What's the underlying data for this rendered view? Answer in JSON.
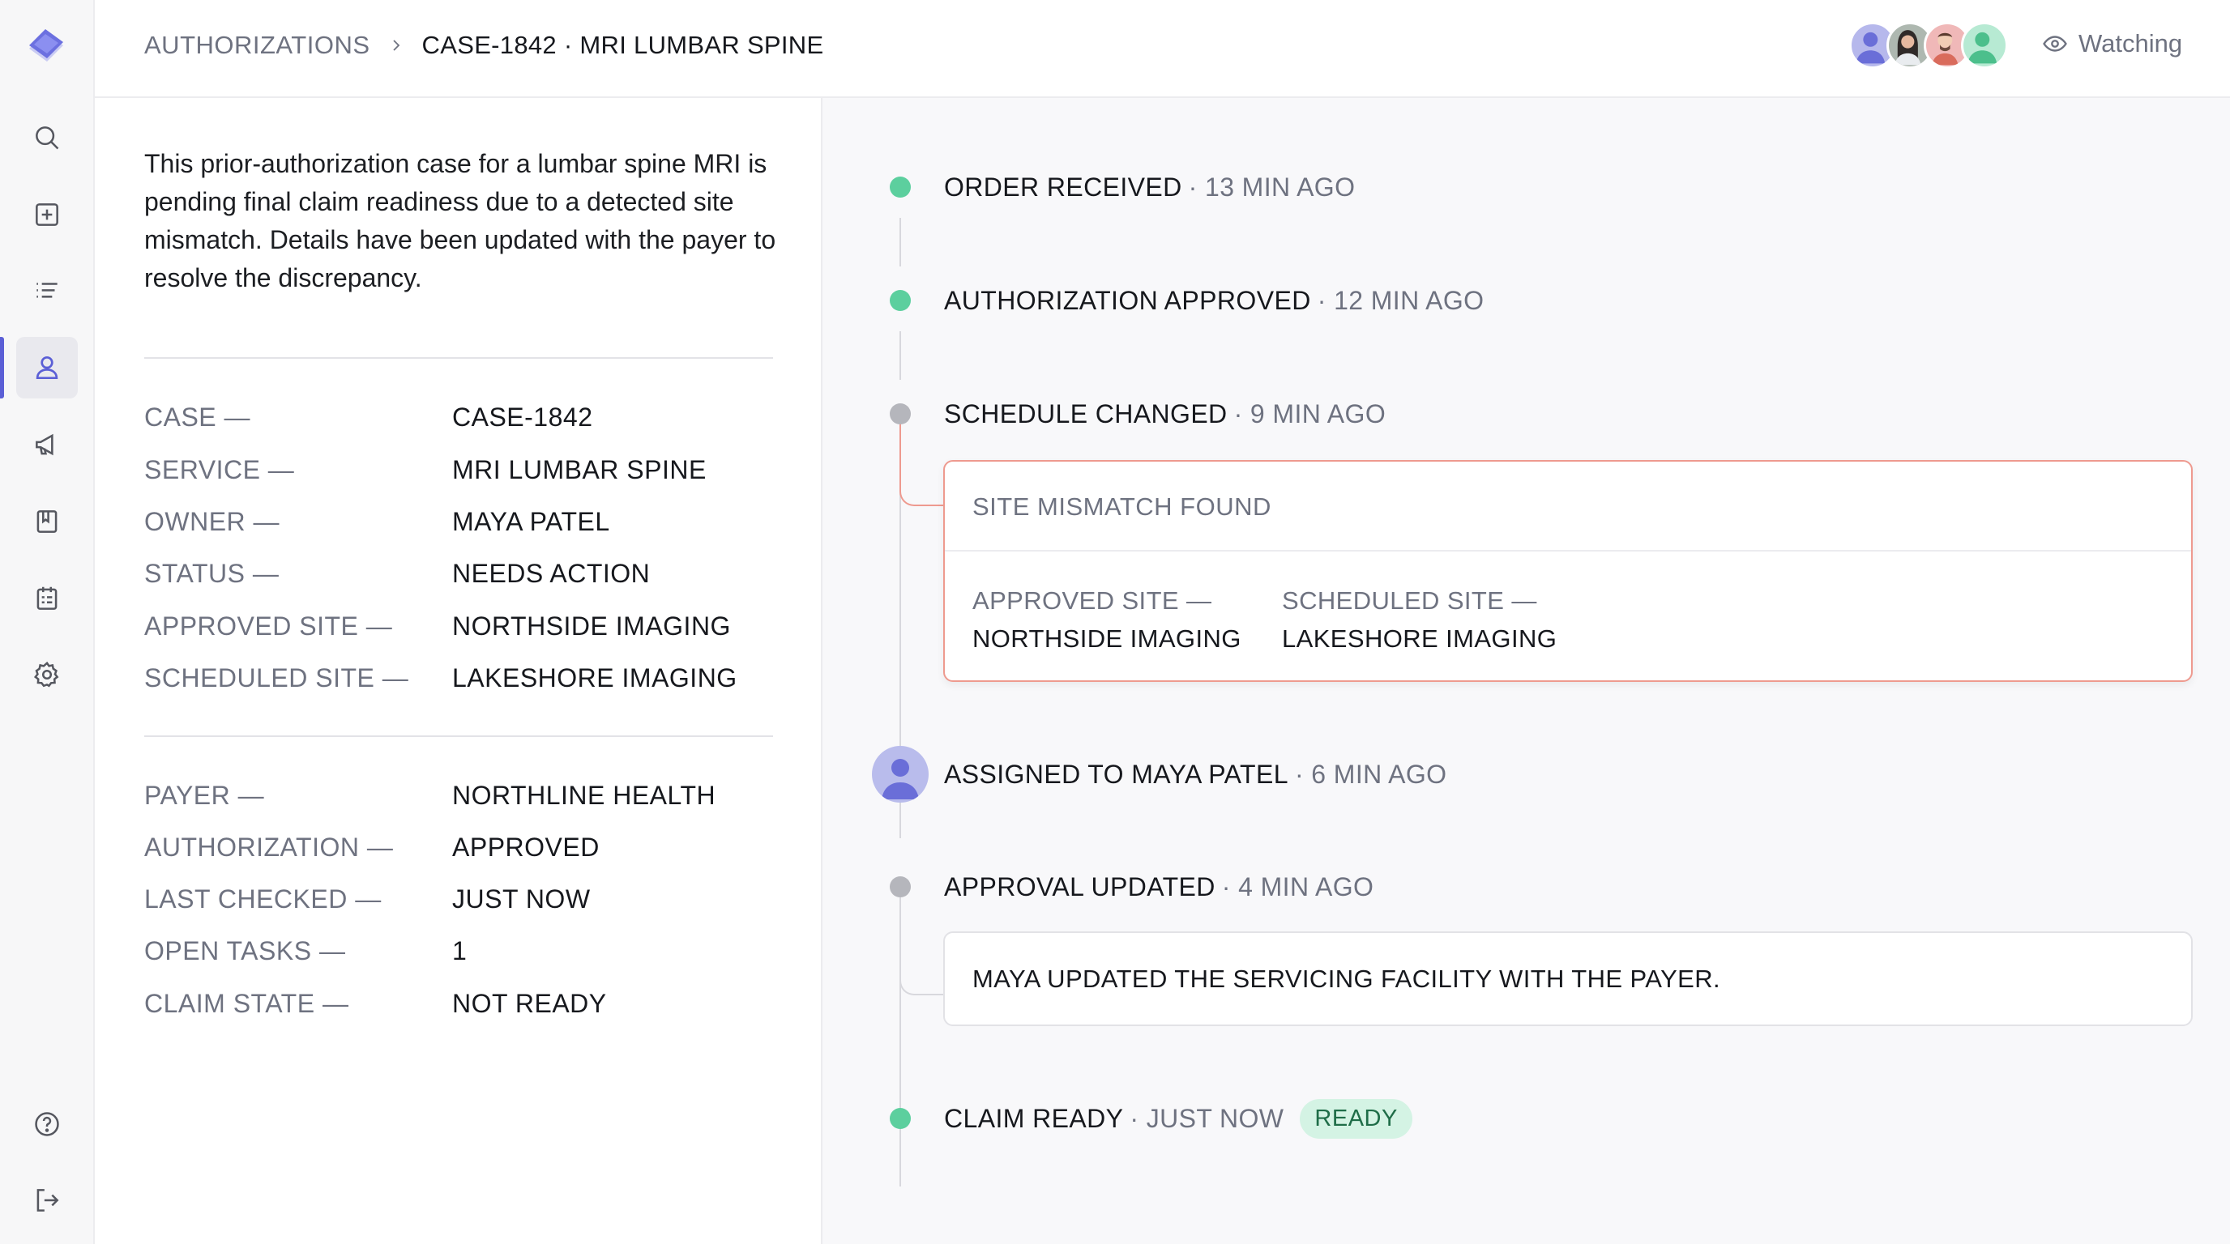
{
  "colors": {
    "accent": "#5b5fd6",
    "status_green": "#5ccf9e",
    "status_gray": "#b5b6bc",
    "alert_border": "#ee9a8f",
    "ready_badge_bg": "#d4f3e4",
    "ready_badge_text": "#1f6d48"
  },
  "sidebar": {
    "logo": "logo-diamond",
    "items": [
      {
        "icon": "search-icon",
        "name": "search"
      },
      {
        "icon": "plus-square-icon",
        "name": "new"
      },
      {
        "icon": "list-icon",
        "name": "list"
      },
      {
        "icon": "user-icon",
        "name": "authorizations",
        "active": true
      },
      {
        "icon": "megaphone-icon",
        "name": "announcements"
      },
      {
        "icon": "book-icon",
        "name": "guides"
      },
      {
        "icon": "calendar-icon",
        "name": "schedule"
      },
      {
        "icon": "gear-icon",
        "name": "settings"
      }
    ],
    "bottom_items": [
      {
        "icon": "help-icon",
        "name": "help"
      },
      {
        "icon": "logout-icon",
        "name": "logout"
      }
    ]
  },
  "header": {
    "breadcrumb_parent": "AUTHORIZATIONS",
    "breadcrumb_current": "CASE-1842 · MRI LUMBAR SPINE",
    "watching_label": "Watching"
  },
  "details": {
    "summary": "This prior-authorization case for a lumbar spine MRI is pending final claim readiness due to a detected site mismatch. Details have been updated with the payer to resolve the discrepancy.",
    "fields_primary": [
      {
        "label": "CASE —",
        "value": "CASE-1842"
      },
      {
        "label": "SERVICE —",
        "value": "MRI LUMBAR SPINE"
      },
      {
        "label": "OWNER —",
        "value": "MAYA PATEL"
      },
      {
        "label": "STATUS —",
        "value": "NEEDS ACTION"
      },
      {
        "label": "APPROVED SITE —",
        "value": "NORTHSIDE IMAGING"
      },
      {
        "label": "SCHEDULED SITE —",
        "value": "LAKESHORE IMAGING"
      }
    ],
    "fields_secondary": [
      {
        "label": "PAYER —",
        "value": "NORTHLINE HEALTH"
      },
      {
        "label": "AUTHORIZATION —",
        "value": "APPROVED"
      },
      {
        "label": "LAST CHECKED —",
        "value": "JUST NOW"
      },
      {
        "label": "OPEN TASKS —",
        "value": "1"
      },
      {
        "label": "CLAIM STATE —",
        "value": "NOT READY"
      }
    ]
  },
  "timeline": {
    "events": [
      {
        "title": "ORDER RECEIVED",
        "time": "· 13 MIN AGO",
        "status": "green"
      },
      {
        "title": "AUTHORIZATION APPROVED",
        "time": "· 12 MIN AGO",
        "status": "green"
      },
      {
        "title": "SCHEDULE CHANGED",
        "time": "· 9 MIN AGO",
        "status": "gray"
      },
      {
        "title": "ASSIGNED TO MAYA PATEL",
        "time": "· 6 MIN AGO",
        "status": "avatar"
      },
      {
        "title": "APPROVAL UPDATED",
        "time": "· 4 MIN AGO",
        "status": "gray"
      },
      {
        "title": "CLAIM READY",
        "time": "· JUST NOW",
        "status": "green",
        "badge": "READY"
      }
    ],
    "mismatch": {
      "heading": "SITE MISMATCH FOUND",
      "approved_label": "APPROVED SITE —",
      "approved_value": "NORTHSIDE IMAGING",
      "scheduled_label": "SCHEDULED SITE —",
      "scheduled_value": "LAKESHORE IMAGING"
    },
    "note": "MAYA UPDATED THE SERVICING FACILITY WITH THE PAYER."
  }
}
